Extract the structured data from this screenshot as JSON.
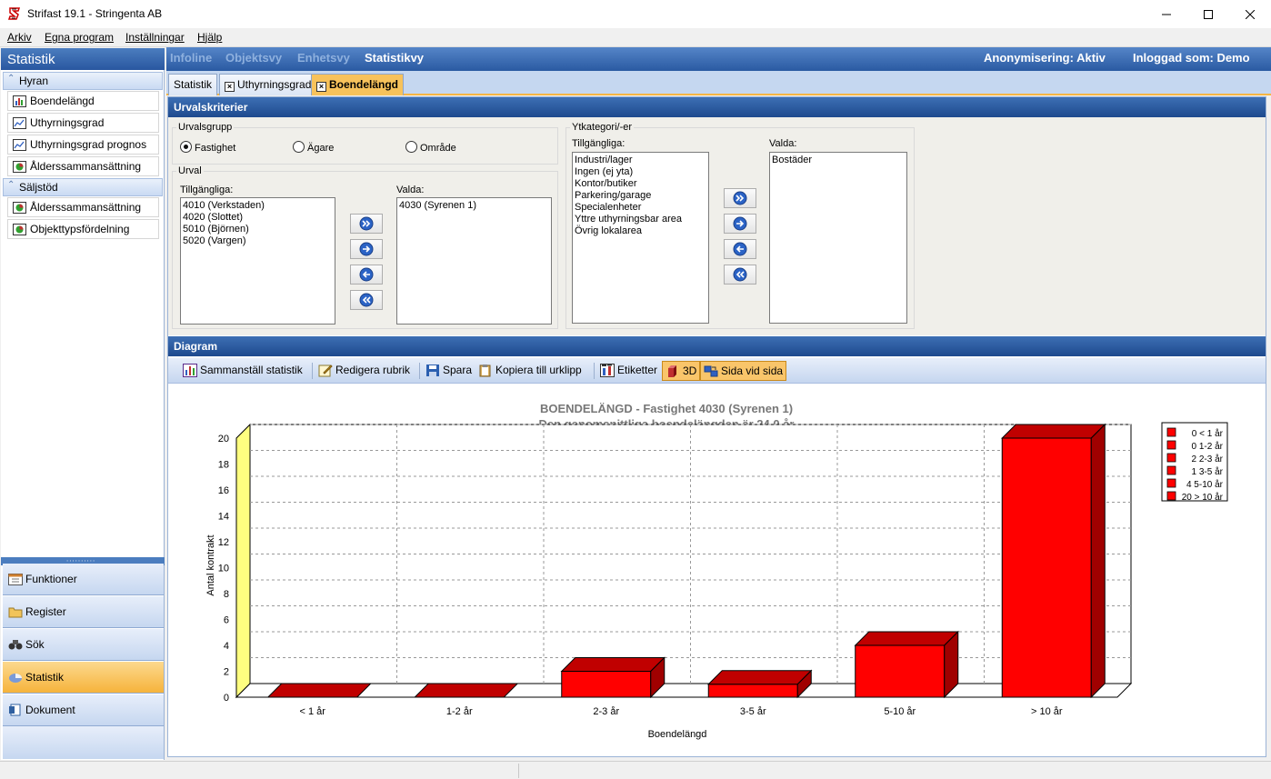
{
  "window": {
    "title": "Strifast 19.1 - Stringenta AB"
  },
  "menu": [
    "Arkiv",
    "Egna program",
    "Inställningar",
    "Hjälp"
  ],
  "sidebar": {
    "title": "Statistik",
    "groups": [
      {
        "label": "Hyran",
        "items": [
          "Boendelängd",
          "Uthyrningsgrad",
          "Uthyrningsgrad prognos",
          "Ålderssammansättning"
        ]
      },
      {
        "label": "Säljstöd",
        "items": [
          "Ålderssammansättning",
          "Objekttypsfördelning"
        ]
      }
    ],
    "nav": [
      {
        "label": "Funktioner",
        "icon": "calendar-icon"
      },
      {
        "label": "Register",
        "icon": "folder-icon"
      },
      {
        "label": "Sök",
        "icon": "binoculars-icon"
      },
      {
        "label": "Statistik",
        "icon": "chart-icon"
      },
      {
        "label": "Dokument",
        "icon": "document-icon"
      }
    ]
  },
  "header": {
    "links": [
      "Infoline",
      "Objektsvy",
      "Enhetsvy",
      "Statistikvy"
    ],
    "anonymization": "Anonymisering: Aktiv",
    "logged_in": "Inloggad som: Demo"
  },
  "tabs": [
    "Statistik",
    "Uthyrningsgrad",
    "Boendelängd"
  ],
  "criteria": {
    "title": "Urvalskriterier",
    "group_legend": "Urvalsgrupp",
    "radios": [
      "Fastighet",
      "Ägare",
      "Område"
    ],
    "selected_radio": "Fastighet",
    "urval_legend": "Urval",
    "available_label": "Tillgängliga:",
    "selected_label": "Valda:",
    "urval_available": [
      "4010 (Verkstaden)",
      "4020 (Slottet)",
      "5010 (Björnen)",
      "5020 (Vargen)"
    ],
    "urval_selected": [
      "4030 (Syrenen 1)"
    ],
    "yt_legend": "Ytkategori/-er",
    "yt_available": [
      "Industri/lager",
      "Ingen (ej yta)",
      "Kontor/butiker",
      "Parkering/garage",
      "Specialenheter",
      "Yttre uthyrningsbar area",
      "Övrig lokalarea"
    ],
    "yt_selected": [
      "Bostäder"
    ]
  },
  "diagram": {
    "title": "Diagram",
    "toolbar": [
      "Sammanställ statistik",
      "Redigera rubrik",
      "Spara",
      "Kopiera till urklipp",
      "Etiketter",
      "3D",
      "Sida vid sida"
    ]
  },
  "chart_data": {
    "type": "bar",
    "title": "BOENDELÄNGD - Fastighet 4030 (Syrenen 1)",
    "subtitle": "Den genomsnittliga boendelängden är 24,0 år",
    "categories": [
      "< 1 år",
      "1-2 år",
      "2-3 år",
      "3-5 år",
      "5-10 år",
      "> 10 år"
    ],
    "values": [
      0,
      0,
      2,
      1,
      4,
      20
    ],
    "xlabel": "Boendelängd",
    "ylabel": "Antal kontrakt",
    "ylim": [
      0,
      20
    ],
    "yticks": [
      0,
      2,
      4,
      6,
      8,
      10,
      12,
      14,
      16,
      18,
      20
    ],
    "legend": [
      "0 < 1 år",
      "0 1-2 år",
      "2 2-3 år",
      "1 3-5 år",
      "4 5-10 år",
      "20 > 10 år"
    ],
    "legend_position": "top-right",
    "grid": true,
    "style": "3d",
    "colors": {
      "bar_front": "#ff0000",
      "bar_top": "#c00000",
      "bar_side": "#a00000",
      "wall": "#ffff80"
    }
  }
}
